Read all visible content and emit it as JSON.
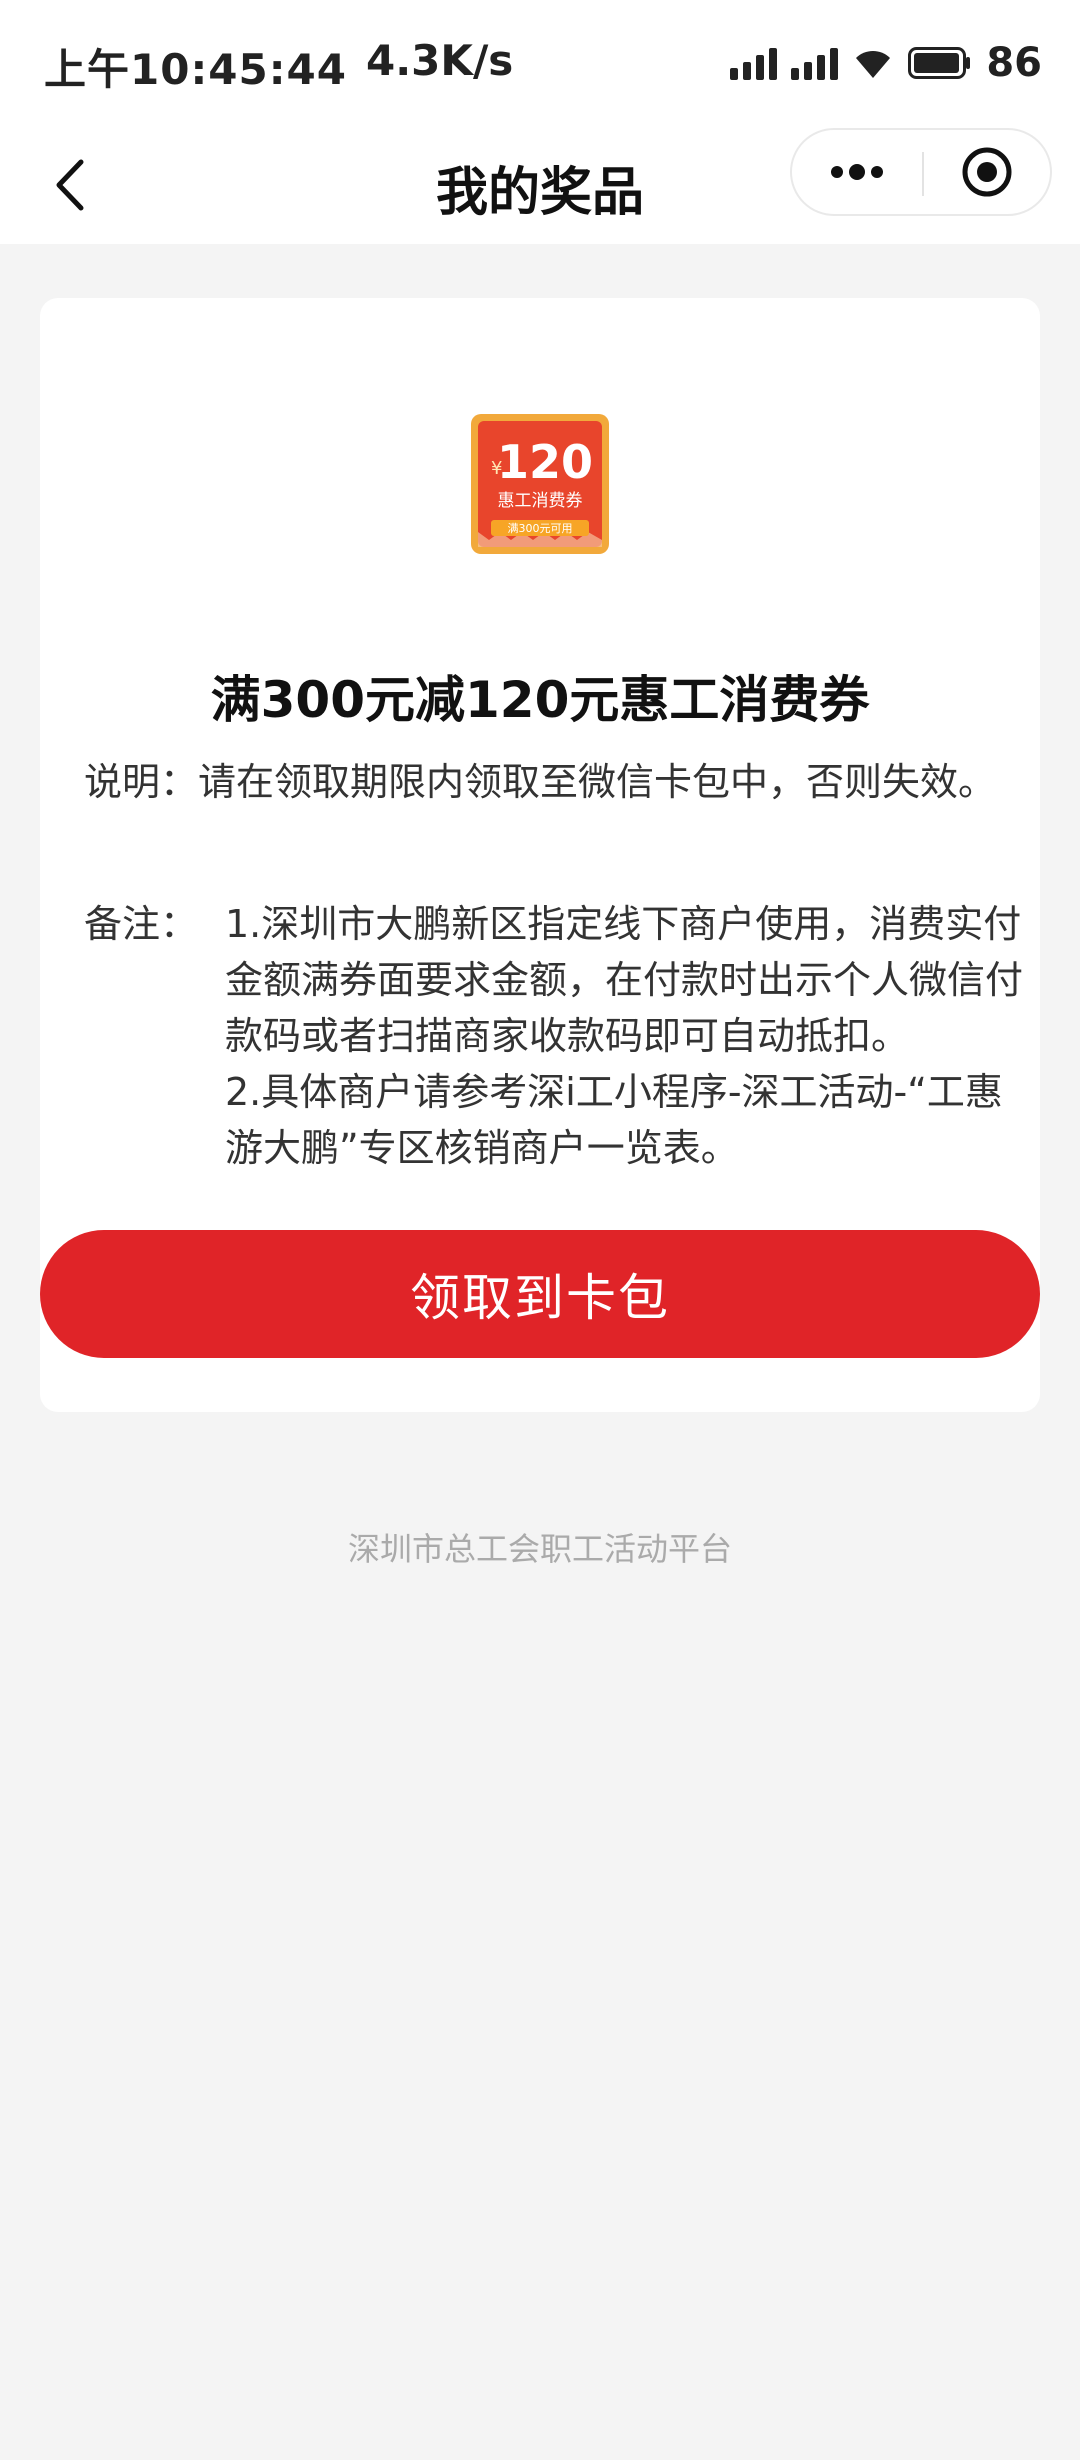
{
  "status_bar": {
    "time": "上午10:45:44",
    "net_speed": "4.3K/s",
    "battery": "86"
  },
  "nav": {
    "title": "我的奖品"
  },
  "coupon": {
    "amount": "120",
    "currency": "¥",
    "badge_name": "惠工消费券",
    "badge_condition": "满300元可用",
    "title": "满300元减120元惠工消费券",
    "description": "说明：请在领取期限内领取至微信卡包中，否则失效。",
    "note_label": "备注：",
    "note_line1": "1.深圳市大鹏新区指定线下商户使用，消费实付金额满券面要求金额，在付款时出示个人微信付款码或者扫描商家收款码即可自动抵扣。",
    "note_line2": "2.具体商户请参考深i工小程序-深工活动-“工惠游大鹏”专区核销商户一览表。"
  },
  "claim_button": "领取到卡包",
  "footer": "深圳市总工会职工活动平台",
  "colors": {
    "accent": "#e02428",
    "page_bg": "#f4f4f4"
  }
}
